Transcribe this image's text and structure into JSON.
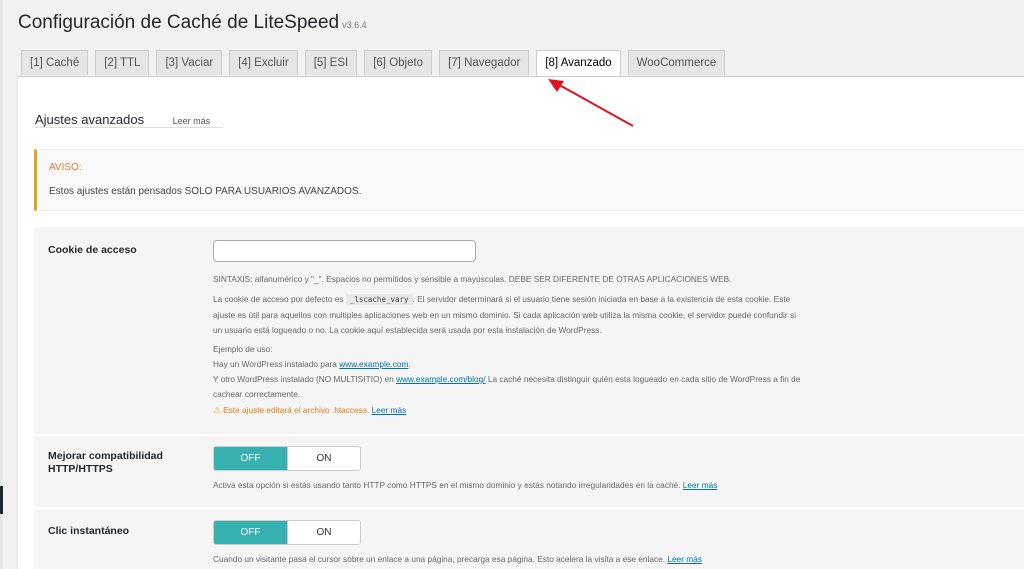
{
  "header": {
    "title": "Configuración de Caché de LiteSpeed",
    "version": "v3.6.4"
  },
  "tabs": [
    {
      "label": "[1] Caché",
      "active": false
    },
    {
      "label": "[2] TTL",
      "active": false
    },
    {
      "label": "[3] Vaciar",
      "active": false
    },
    {
      "label": "[4] Excluir",
      "active": false
    },
    {
      "label": "[5] ESI",
      "active": false
    },
    {
      "label": "[6] Objeto",
      "active": false
    },
    {
      "label": "[7] Navegador",
      "active": false
    },
    {
      "label": "[8] Avanzado",
      "active": true
    },
    {
      "label": "WooCommerce",
      "active": false
    }
  ],
  "section": {
    "title": "Ajustes avanzados",
    "learn_more": "Leer más"
  },
  "notice": {
    "title": "AVISO:",
    "text": "Estos ajustes están pensados SOLO PARA USUARIOS AVANZADOS."
  },
  "login_cookie": {
    "label": "Cookie de acceso",
    "value": "",
    "syntax": "SINTAXIS: alfanumérico y \"_\". Espacios no permitidos y sensible a mayúsculas. DEBE SER DIFERENTE DE OTRAS APLICACIONES WEB.",
    "desc1_pre": "La cookie de acceso por defecto es",
    "desc1_code": "_lscache_vary",
    "desc1_post": ". El servidor determinará si el usuario tiene sesión iniciada en base a la existencia de esta cookie. Este",
    "desc2": "ajuste es útil para aquellos con multiples aplicaciones web en un mismo dominio. Si cada aplicación web utiliza la misma cookie, el servidor puede confundir si",
    "desc3": "un usuario está logueado o no. La cookie aquí establecida será usada por esta instalación de WordPress.",
    "example_title": "Ejemplo de uso:",
    "example1_pre": "Hay un WordPress instalado para",
    "example1_link": "www.example.com",
    "example1_post": ".",
    "example2_pre": "Y otro WordPress instalado (NO MULTISITIO) en",
    "example2_link": "www.example.com/blog/",
    "example2_post": "La caché necesita distinguir quién esta logueado en cada sitio de WordPress a fin de",
    "example3": "cachear correctamente.",
    "warning": "Este ajuste editará el archivo .htaccess.",
    "warning_link": "Leer más"
  },
  "http_https": {
    "label": "Mejorar compatibilidad HTTP/HTTPS",
    "off": "OFF",
    "on": "ON",
    "selected": "OFF",
    "desc": "Activa esta opción si estás usando tanto HTTP como HTTPS en el mismo dominio y estás notando irregularidades en la caché.",
    "link": "Leer más"
  },
  "instant_click": {
    "label": "Clic instantáneo",
    "off": "OFF",
    "on": "ON",
    "selected": "OFF",
    "desc": "Cuando un visitante pasa el cursor sobre un enlace a una página, precarga esa página. Esto acelera la visita a ese enlace.",
    "link": "Leer más"
  },
  "colors": {
    "accent": "#36b0b0",
    "arrow": "#e0141e",
    "notice_border": "#dba617",
    "link": "#0073aa"
  }
}
